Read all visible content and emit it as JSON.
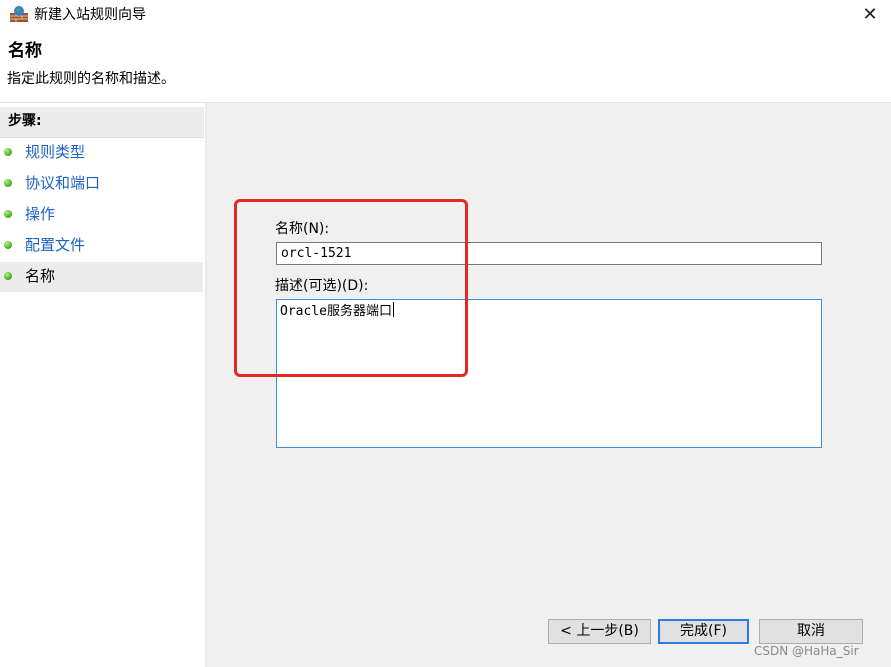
{
  "window": {
    "title": "新建入站规则向导",
    "close_glyph": "✕",
    "icon": "firewall-icon"
  },
  "header": {
    "heading": "名称",
    "subheading": "指定此规则的名称和描述。"
  },
  "sidebar": {
    "title": "步骤:",
    "steps": [
      {
        "label": "规则类型",
        "selected": false
      },
      {
        "label": "协议和端口",
        "selected": false
      },
      {
        "label": "操作",
        "selected": false
      },
      {
        "label": "配置文件",
        "selected": false
      },
      {
        "label": "名称",
        "selected": true
      }
    ]
  },
  "form": {
    "name_label": "名称(N):",
    "name_value": "orcl-1521",
    "description_label": "描述(可选)(D):",
    "description_value": "Oracle服务器端口"
  },
  "buttons": {
    "back": "< 上一步(B)",
    "finish": "完成(F)",
    "cancel": "取消"
  },
  "watermark": "CSDN @HaHa_Sir",
  "colors": {
    "link": "#1c63c5",
    "highlight_border": "#e02b24",
    "focus_border": "#3f8fd6",
    "default_button_border": "#2b7ae0"
  }
}
